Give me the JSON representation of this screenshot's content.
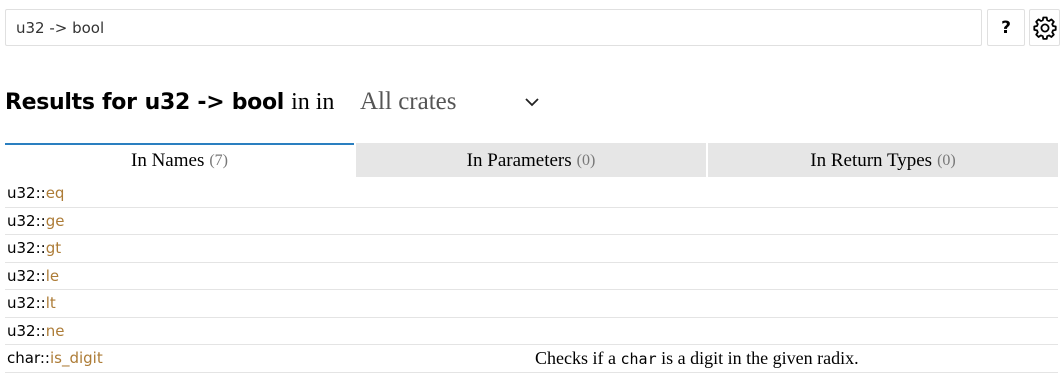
{
  "search": {
    "value": "u32 -> bool",
    "help_label": "?",
    "settings_icon": "gear-icon"
  },
  "heading": {
    "label": "Results for",
    "query": "u32 -> bool",
    "in_text": "in in",
    "crate_value": "All crates",
    "chevron_icon": "chevron-down-icon"
  },
  "tabs": [
    {
      "label": "In Names",
      "count": "(7)",
      "active": true
    },
    {
      "label": "In Parameters",
      "count": "(0)",
      "active": false
    },
    {
      "label": "In Return Types",
      "count": "(0)",
      "active": false
    }
  ],
  "results": [
    {
      "prefix": "u32::",
      "name": "eq",
      "desc": ""
    },
    {
      "prefix": "u32::",
      "name": "ge",
      "desc": ""
    },
    {
      "prefix": "u32::",
      "name": "gt",
      "desc": ""
    },
    {
      "prefix": "u32::",
      "name": "le",
      "desc": ""
    },
    {
      "prefix": "u32::",
      "name": "lt",
      "desc": ""
    },
    {
      "prefix": "u32::",
      "name": "ne",
      "desc": ""
    },
    {
      "prefix": "char::",
      "name": "is_digit",
      "desc_before": "Checks if a ",
      "desc_code": "char",
      "desc_after": " is a digit in the given radix."
    }
  ],
  "colors": {
    "accent_tab": "#2a7fc0",
    "fn_name": "#ad7c37",
    "tab_bg": "#e6e6e6"
  }
}
